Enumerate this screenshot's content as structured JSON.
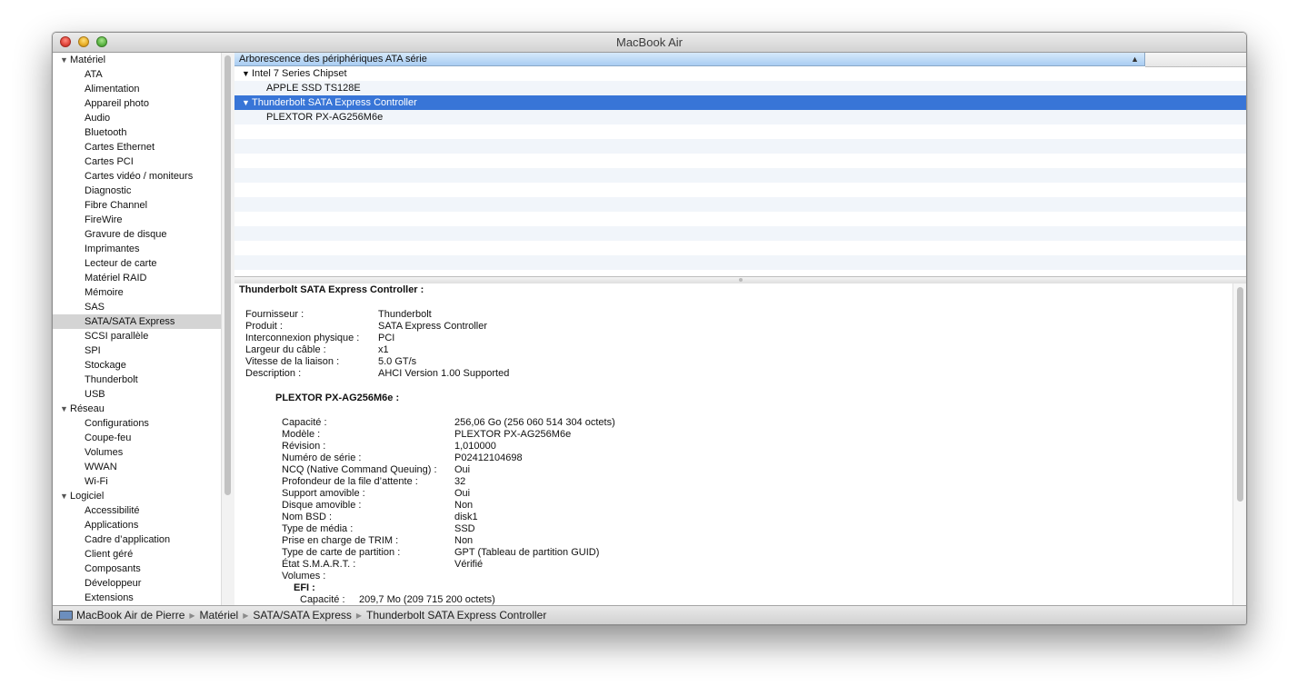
{
  "window": {
    "title": "MacBook Air"
  },
  "sidebar": {
    "groups": [
      {
        "label": "Matériel",
        "items": [
          "ATA",
          "Alimentation",
          "Appareil photo",
          "Audio",
          "Bluetooth",
          "Cartes Ethernet",
          "Cartes PCI",
          "Cartes vidéo / moniteurs",
          "Diagnostic",
          "Fibre Channel",
          "FireWire",
          "Gravure de disque",
          "Imprimantes",
          "Lecteur de carte",
          "Matériel RAID",
          "Mémoire",
          "SAS",
          "SATA/SATA Express",
          "SCSI parallèle",
          "SPI",
          "Stockage",
          "Thunderbolt",
          "USB"
        ]
      },
      {
        "label": "Réseau",
        "items": [
          "Configurations",
          "Coupe-feu",
          "Volumes",
          "WWAN",
          "Wi-Fi"
        ]
      },
      {
        "label": "Logiciel",
        "items": [
          "Accessibilité",
          "Applications",
          "Cadre d’application",
          "Client géré",
          "Composants",
          "Développeur",
          "Extensions"
        ]
      }
    ],
    "selected": "SATA/SATA Express"
  },
  "tree": {
    "header": "Arborescence des périphériques ATA série",
    "sort_indicator": "▲",
    "rows": [
      {
        "label": "Intel 7 Series Chipset",
        "level": 0,
        "expanded": true
      },
      {
        "label": "APPLE SSD TS128E",
        "level": 1
      },
      {
        "label": "Thunderbolt SATA Express Controller",
        "level": 0,
        "expanded": true,
        "selected": true
      },
      {
        "label": "PLEXTOR PX-AG256M6e",
        "level": 1
      }
    ]
  },
  "detail": {
    "title": "Thunderbolt SATA Express Controller :",
    "controller": [
      {
        "k": "Fournisseur :",
        "v": "Thunderbolt"
      },
      {
        "k": "Produit :",
        "v": "SATA Express Controller"
      },
      {
        "k": "Interconnexion physique :",
        "v": "PCI"
      },
      {
        "k": "Largeur du câble :",
        "v": "x1"
      },
      {
        "k": "Vitesse de la liaison :",
        "v": "5.0 GT/s"
      },
      {
        "k": "Description :",
        "v": "AHCI Version 1.00 Supported"
      }
    ],
    "device_title": "PLEXTOR PX-AG256M6e :",
    "device": [
      {
        "k": "Capacité :",
        "v": "256,06 Go (256 060 514 304 octets)"
      },
      {
        "k": "Modèle :",
        "v": "PLEXTOR PX-AG256M6e"
      },
      {
        "k": "Révision :",
        "v": "1,010000"
      },
      {
        "k": "Numéro de série :",
        "v": "P02412104698"
      },
      {
        "k": "NCQ (Native Command Queuing) :",
        "v": "Oui"
      },
      {
        "k": "Profondeur de la file d’attente :",
        "v": "32"
      },
      {
        "k": "Support amovible :",
        "v": "Oui"
      },
      {
        "k": "Disque amovible :",
        "v": "Non"
      },
      {
        "k": "Nom BSD :",
        "v": "disk1"
      },
      {
        "k": "Type de média :",
        "v": "SSD"
      },
      {
        "k": "Prise en charge de TRIM :",
        "v": "Non"
      },
      {
        "k": "Type de carte de partition :",
        "v": "GPT (Tableau de partition GUID)"
      },
      {
        "k": "État S.M.A.R.T. :",
        "v": "Vérifié"
      },
      {
        "k": "Volumes :",
        "v": ""
      }
    ],
    "volume_title": "EFI :",
    "volume_capacity_label": "Capacité :",
    "volume_capacity_value": "209,7 Mo (209 715 200 octets)"
  },
  "statusbar": {
    "crumbs": [
      "MacBook Air de Pierre",
      "Matériel",
      "SATA/SATA Express",
      "Thunderbolt SATA Express Controller"
    ],
    "separator": "▶"
  }
}
